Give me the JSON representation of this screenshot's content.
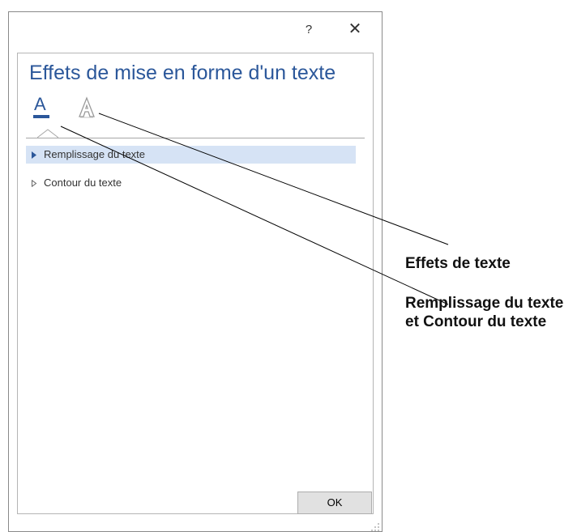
{
  "dialog": {
    "help_label": "?",
    "close_label": "✕",
    "title": "Effets de mise en forme d'un texte",
    "tabs": [
      {
        "label": "A",
        "icon": "text-fill-icon",
        "selected": true
      },
      {
        "label": "A",
        "icon": "text-effects-icon",
        "selected": false
      }
    ],
    "sections": [
      {
        "label": "Remplissage du texte",
        "highlighted": true
      },
      {
        "label": "Contour du texte",
        "highlighted": false
      }
    ],
    "ok_label": "OK"
  },
  "callouts": {
    "effects": "Effets de texte",
    "fill_outline_line1": "Remplissage du texte",
    "fill_outline_line2": "et Contour du texte"
  },
  "colors": {
    "accent": "#2b579a",
    "highlight": "#d6e3f5",
    "border": "#8a8a8a"
  }
}
